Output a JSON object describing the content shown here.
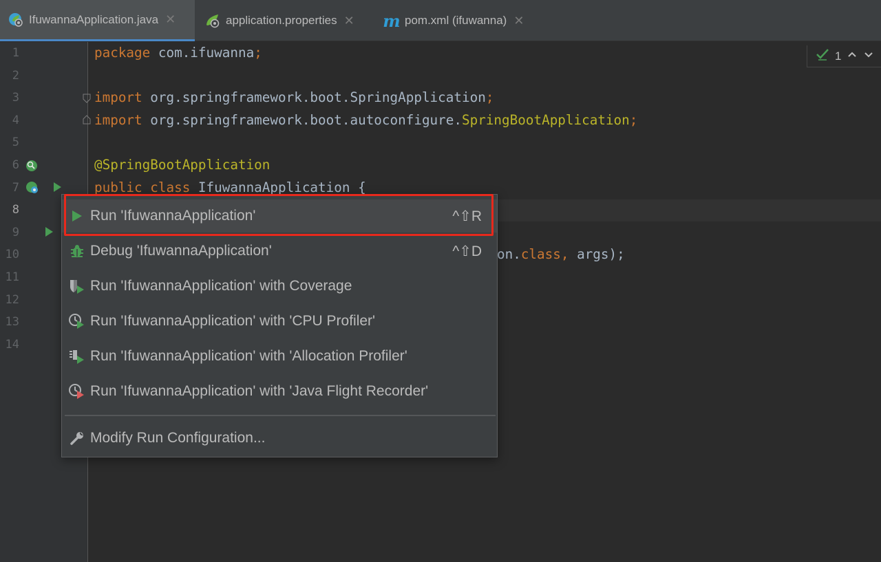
{
  "tabs": [
    {
      "label": "IfuwannaApplication.java",
      "icon": "spring-boot-class-icon",
      "active": true
    },
    {
      "label": "application.properties",
      "icon": "spring-properties-icon",
      "active": false
    },
    {
      "label": "pom.xml (ifuwanna)",
      "icon": "maven-icon",
      "active": false
    }
  ],
  "inspection": {
    "count": "1"
  },
  "line_numbers": [
    "1",
    "2",
    "3",
    "4",
    "5",
    "6",
    "7",
    "8",
    "9",
    "10",
    "11",
    "12",
    "13",
    "14"
  ],
  "code": {
    "l1_kw": "package",
    "l1_rest": " com.ifuwanna",
    "l1_semi": ";",
    "l3_kw": "import",
    "l3_rest": " org.springframework.boot.SpringApplication",
    "l3_semi": ";",
    "l4_kw": "import",
    "l4_rest": " org.springframework.boot.autoconfigure.",
    "l4_cls": "SpringBootApplication",
    "l4_semi": ";",
    "l6_ann": "@SpringBootApplication",
    "l7_kw": "public class",
    "l7_rest": " IfuwannaApplication {",
    "l10_tail_a": "on.",
    "l10_tail_kw": "class",
    "l10_tail_comma": ",",
    "l10_tail_b": " args);"
  },
  "menu": {
    "items": [
      {
        "label": "Run 'IfuwannaApplication'",
        "shortcut": "^⇧R",
        "icon": "run-icon"
      },
      {
        "label": "Debug 'IfuwannaApplication'",
        "shortcut": "^⇧D",
        "icon": "debug-icon"
      },
      {
        "label": "Run 'IfuwannaApplication' with Coverage",
        "shortcut": "",
        "icon": "coverage-icon"
      },
      {
        "label": "Run 'IfuwannaApplication' with 'CPU Profiler'",
        "shortcut": "",
        "icon": "cpu-profiler-icon"
      },
      {
        "label": "Run 'IfuwannaApplication' with 'Allocation Profiler'",
        "shortcut": "",
        "icon": "allocation-profiler-icon"
      },
      {
        "label": "Run 'IfuwannaApplication' with 'Java Flight Recorder'",
        "shortcut": "",
        "icon": "flight-recorder-icon"
      }
    ],
    "modify": {
      "label": "Modify Run Configuration...",
      "icon": "wrench-icon"
    }
  },
  "colors": {
    "accent": "#4a88c7",
    "run_green": "#499c54",
    "highlight_red": "#e8291c"
  }
}
